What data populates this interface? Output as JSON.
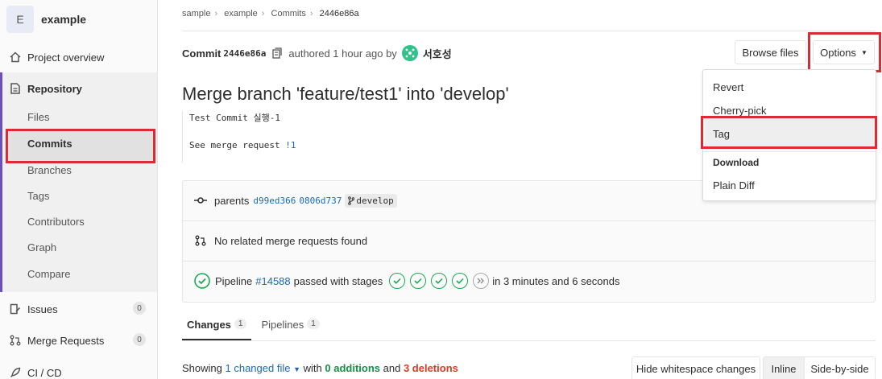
{
  "sidebar": {
    "project_initial": "E",
    "project_name": "example",
    "items": {
      "overview": "Project overview",
      "repository": "Repository",
      "files": "Files",
      "commits": "Commits",
      "branches": "Branches",
      "tags": "Tags",
      "contributors": "Contributors",
      "graph": "Graph",
      "compare": "Compare",
      "issues": "Issues",
      "issues_count": "0",
      "merge_requests": "Merge Requests",
      "mr_count": "0",
      "cicd": "CI / CD"
    }
  },
  "breadcrumb": [
    "sample",
    "example",
    "Commits",
    "2446e86a"
  ],
  "commit": {
    "label": "Commit",
    "sha": "2446e86a",
    "authored": "authored 1 hour ago by",
    "author": "서호성",
    "title": "Merge branch 'feature/test1' into 'develop'",
    "desc_line1": "Test Commit 실행-1",
    "desc_line2_prefix": "See merge request ",
    "desc_line2_link": "!1"
  },
  "buttons": {
    "browse_files": "Browse files",
    "options": "Options"
  },
  "dropdown": {
    "revert": "Revert",
    "cherry_pick": "Cherry-pick",
    "tag": "Tag",
    "download_header": "Download",
    "plain_diff": "Plain Diff"
  },
  "info": {
    "parents_label": "parents",
    "parent1": "d99ed366",
    "parent2": "0806d737",
    "branch": "develop",
    "no_mr": "No related merge requests found",
    "pipeline_label": "Pipeline",
    "pipeline_id": "#14588",
    "passed": "passed with stages",
    "duration": "in 3 minutes and 6 seconds"
  },
  "tabs": {
    "changes": "Changes",
    "changes_count": "1",
    "pipelines": "Pipelines",
    "pipelines_count": "1"
  },
  "diff": {
    "showing": "Showing",
    "changed": "1 changed file",
    "with": "with",
    "additions": "0 additions",
    "and": "and",
    "deletions": "3 deletions",
    "hide_ws": "Hide whitespace changes",
    "inline": "Inline",
    "side_by_side": "Side-by-side"
  },
  "colors": {
    "accent": "#6b4fbb",
    "highlight": "#dd2b33",
    "link": "#1b69b6",
    "success": "#1aaa55"
  }
}
